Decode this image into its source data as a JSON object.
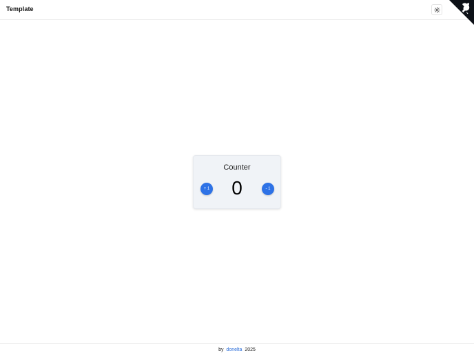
{
  "header": {
    "title": "Template",
    "theme_toggle_icon": "sun-icon",
    "corner_icon": "github-icon"
  },
  "card": {
    "title": "Counter",
    "value": "0",
    "increment_label": "+ 1",
    "decrement_label": "- 1"
  },
  "footer": {
    "prefix": "by",
    "author": "donelta",
    "year": "2025"
  },
  "colors": {
    "accent": "#2e72e6",
    "card_bg": "#f0f3f7",
    "link": "#2e6fd9",
    "ribbon": "#0d1117"
  }
}
